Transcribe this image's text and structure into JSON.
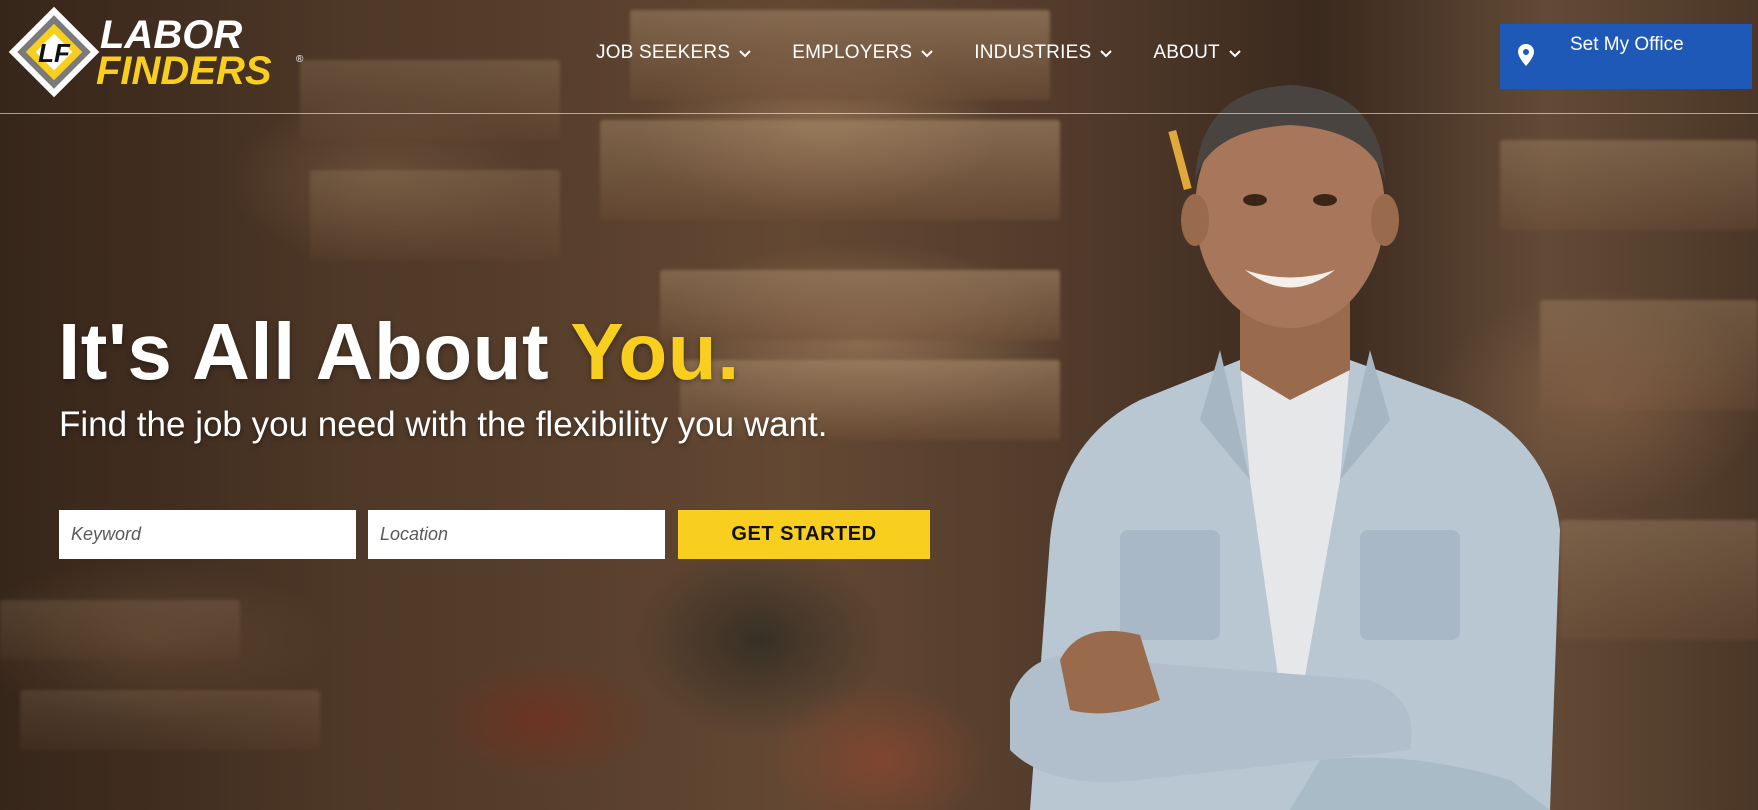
{
  "brand": {
    "logo_line1": "LABOR",
    "logo_line2": "FINDERS",
    "logo_monogram": "LF",
    "registered_mark": "®",
    "colors": {
      "yellow": "#f8cf1f",
      "blue": "#1e59b8",
      "white": "#ffffff"
    }
  },
  "nav": {
    "items": [
      {
        "label": "JOB SEEKERS",
        "icon": "chevron-down-icon"
      },
      {
        "label": "EMPLOYERS",
        "icon": "chevron-down-icon"
      },
      {
        "label": "INDUSTRIES",
        "icon": "chevron-down-icon"
      },
      {
        "label": "ABOUT",
        "icon": "chevron-down-icon"
      }
    ],
    "office_button": {
      "label": "Set My Office",
      "icon": "map-pin-icon"
    }
  },
  "hero": {
    "headline_main": "It's All About ",
    "headline_accent": "You.",
    "subheadline": "Find the job you need with the flexibility you want."
  },
  "search": {
    "keyword_placeholder": "Keyword",
    "location_placeholder": "Location",
    "submit_label": "GET STARTED"
  }
}
